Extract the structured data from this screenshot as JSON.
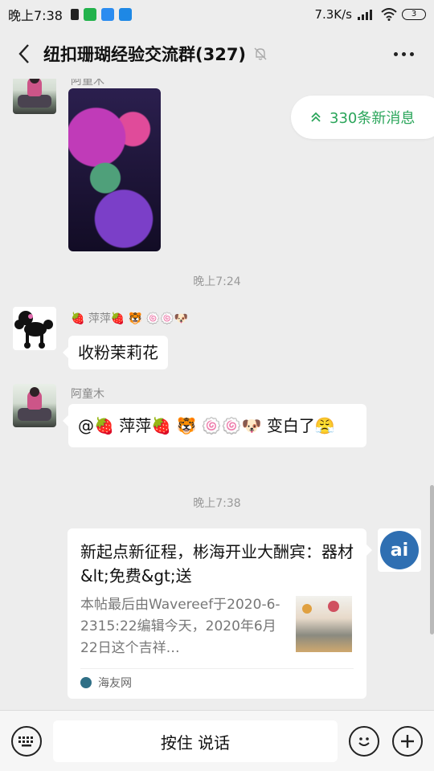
{
  "status": {
    "time": "晚上7:38",
    "speed": "7.3K/s",
    "battery": "3"
  },
  "header": {
    "title": "纽扣珊瑚经验交流群(327)"
  },
  "new_messages": {
    "label": "330条新消息"
  },
  "messages": {
    "m1_sender": "阿童木",
    "t1": "晚上7:24",
    "m2_sender": "🍓 萍萍🍓 🐯 🍥🍥🐶",
    "m2_text": "收粉茉莉花",
    "m3_sender": "阿童木",
    "m3_text": "@🍓 萍萍🍓 🐯 🍥🍥🐶 变白了😤",
    "t2": "晚上7:38"
  },
  "card": {
    "title": "新起点新征程，彬海开业大酬宾：器材&lt;免费&gt;送",
    "desc": "本帖最后由Wavereef于2020-6-2315:22编辑今天，2020年6月22日这个吉祥…",
    "source": "海友网",
    "avatar_text": "ai"
  },
  "bottom": {
    "hold_to_talk": "按住 说话"
  },
  "colors": {
    "accent_green": "#2aa55a",
    "chat_bg": "#ededed"
  }
}
